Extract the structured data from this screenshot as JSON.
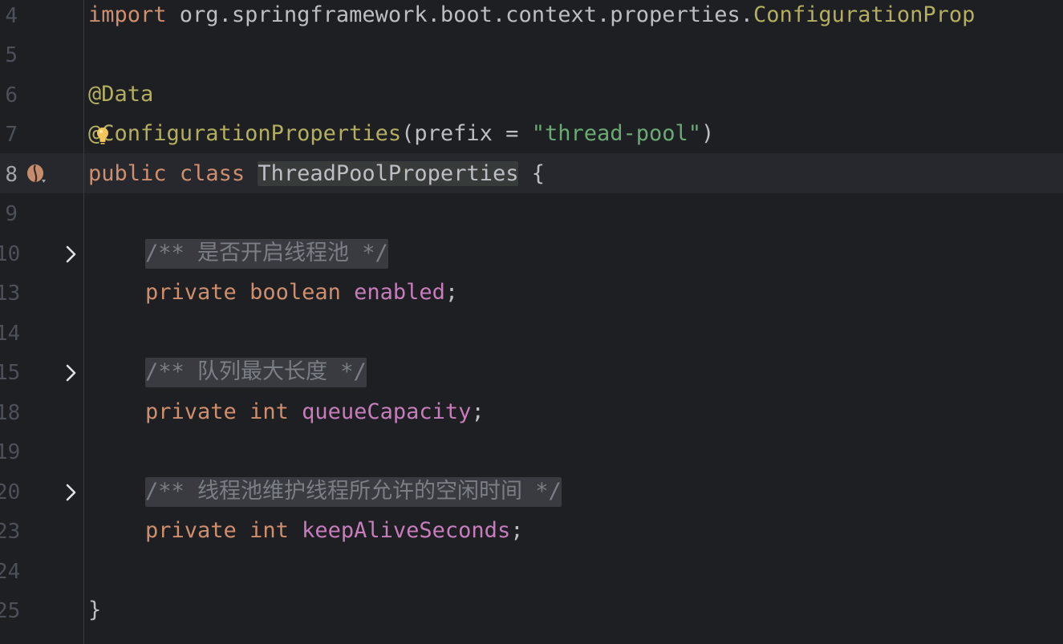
{
  "editor": {
    "current_line": "8",
    "lines": [
      {
        "num": "4",
        "t1": "import",
        "t2": " org.springframework.boot.context.properties.",
        "t3": "ConfigurationProp"
      },
      {
        "num": "5"
      },
      {
        "num": "6",
        "t1": "@Data"
      },
      {
        "num": "7",
        "t1": "@ConfigurationProperties",
        "t2": "(prefix = ",
        "t3": "\"thread-pool\"",
        "t4": ")"
      },
      {
        "num": "8",
        "t1": "public",
        "t2": " ",
        "t3": "class",
        "t4": " ",
        "t5": "ThreadPoolProperties",
        "t6": " {"
      },
      {
        "num": "9"
      },
      {
        "num": "10",
        "t1": "/** 是否开启线程池 */"
      },
      {
        "num": "13",
        "t1": "private",
        "t2": " ",
        "t3": "boolean",
        "t4": " ",
        "t5": "enabled",
        "t6": ";"
      },
      {
        "num": "14"
      },
      {
        "num": "15",
        "t1": "/** 队列最大长度 */"
      },
      {
        "num": "18",
        "t1": "private",
        "t2": " ",
        "t3": "int",
        "t4": " ",
        "t5": "queueCapacity",
        "t6": ";"
      },
      {
        "num": "19"
      },
      {
        "num": "20",
        "t1": "/** 线程池维护线程所允许的空闲时间 */"
      },
      {
        "num": "23",
        "t1": "private",
        "t2": " ",
        "t3": "int",
        "t4": " ",
        "t5": "keepAliveSeconds",
        "t6": ";"
      },
      {
        "num": "24"
      },
      {
        "num": "25",
        "t1": "}"
      }
    ]
  },
  "icons": {
    "fold": "chevron-right-icon",
    "implicit_usages": "bean-gutter-icon",
    "intention": "lightbulb-icon"
  },
  "colors": {
    "background": "#1e1f22",
    "keyword": "#cf8e6d",
    "annotation": "#b3ae60",
    "string": "#6aab73",
    "field": "#c77dbb",
    "comment": "#7a7e85",
    "text": "#bcbec4"
  }
}
